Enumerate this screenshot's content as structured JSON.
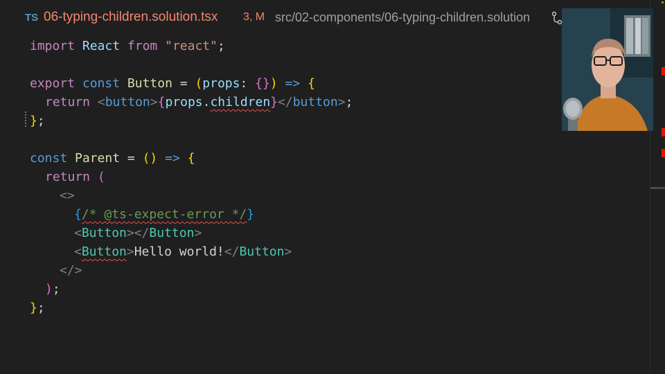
{
  "tab": {
    "language_badge": "TS",
    "filename": "06-typing-children.solution.tsx",
    "status": "3, M",
    "path": "src/02-components/06-typing-children.solution"
  },
  "code": {
    "l1": {
      "import": "import",
      "react": "React",
      "from": "from",
      "module": "\"react\"",
      "semi": ";"
    },
    "l3": {
      "export": "export",
      "const": "const",
      "name": "Button",
      "eq": " = ",
      "paren_open": "(",
      "props": "props",
      "colon": ": ",
      "brace_open": "{",
      "brace_close": "}",
      "paren_close": ")",
      "arrow": " => ",
      "body_open": "{"
    },
    "l4": {
      "return": "return",
      "tag_open": "<",
      "tag": "button",
      "tag_close": ">",
      "expr_open": "{",
      "props": "props",
      "dot": ".",
      "children": "children",
      "expr_close": "}",
      "end_open": "</",
      "end_tag": "button",
      "end_close": ">",
      "semi": ";"
    },
    "l5": {
      "close": "}",
      "semi": ";"
    },
    "l7": {
      "const": "const",
      "name": "Parent",
      "eq": " = ",
      "paren": "()",
      "arrow": " => ",
      "brace": "{"
    },
    "l8": {
      "return": "return",
      "paren": "("
    },
    "l9": {
      "fragment": "<>"
    },
    "l10": {
      "open": "{",
      "comment": "/* @ts-expect-error */",
      "close": "}"
    },
    "l11": {
      "lt": "<",
      "tag": "Button",
      "gt": ">",
      "end_lt": "</",
      "end_tag": "Button",
      "end_gt": ">"
    },
    "l12": {
      "lt": "<",
      "tag": "Button",
      "gt": ">",
      "text": "Hello world!",
      "end_lt": "</",
      "end_tag": "Button",
      "end_gt": ">"
    },
    "l13": {
      "fragment_close": "</>"
    },
    "l14": {
      "paren": ")",
      "semi": ";"
    },
    "l15": {
      "close": "}",
      "semi": ";"
    }
  },
  "colors": {
    "background": "#1f1f1f",
    "error": "#f14c4c",
    "modified_tab": "#f48771"
  },
  "icons": {
    "branch": "git-compare-icon"
  }
}
